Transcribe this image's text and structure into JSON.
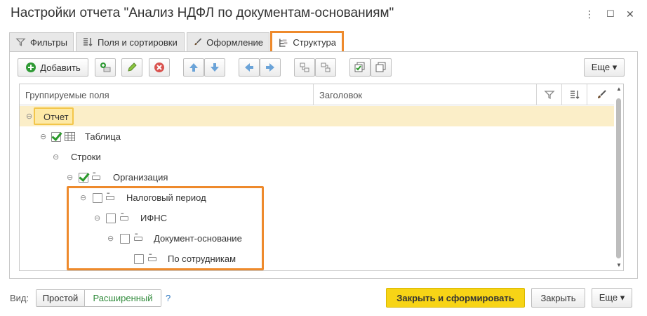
{
  "window": {
    "title": "Настройки отчета \"Анализ НДФЛ по документам-основаниям\"",
    "more_glyph": "⋮",
    "maximize_glyph": "☐",
    "close_glyph": "✕"
  },
  "tabs": [
    {
      "label": "Фильтры",
      "icon": "filter-icon"
    },
    {
      "label": "Поля и сортировки",
      "icon": "fields-sort-icon"
    },
    {
      "label": "Оформление",
      "icon": "brush-icon"
    },
    {
      "label": "Структура",
      "icon": "structure-icon",
      "active": true
    }
  ],
  "toolbar": {
    "add_label": "Добавить",
    "more_label": "Еще ▾"
  },
  "grid": {
    "headers": {
      "grouping": "Группируемые поля",
      "title": "Заголовок"
    },
    "rows": [
      {
        "label": "Отчет",
        "level": 0
      },
      {
        "label": "Таблица",
        "level": 1,
        "checked": true
      },
      {
        "label": "Строки",
        "level": 2
      },
      {
        "label": "Организация",
        "level": 3,
        "checked": true
      },
      {
        "label": "Налоговый период",
        "level": 4,
        "checked": false
      },
      {
        "label": "ИФНС",
        "level": 5,
        "checked": false
      },
      {
        "label": "Документ-основание",
        "level": 6,
        "checked": false
      },
      {
        "label": "По сотрудникам",
        "level": 7,
        "checked": false
      }
    ]
  },
  "footer": {
    "view_label": "Вид:",
    "simple_label": "Простой",
    "extended_label": "Расширенный",
    "help_label": "?",
    "close_and_build_label": "Закрыть и сформировать",
    "close_label": "Закрыть",
    "more_label": "Еще ▾"
  },
  "colors": {
    "accent_orange": "#ee8a2c",
    "primary_yellow": "#f7d416",
    "selection": "#fbeec8",
    "check_green": "#2c9a2c"
  }
}
